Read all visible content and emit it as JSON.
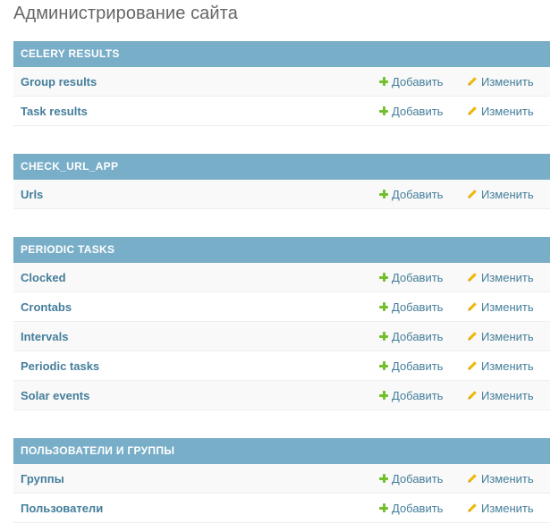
{
  "page_title": "Администрирование сайта",
  "modules": [
    {
      "caption": "CELERY RESULTS",
      "models": [
        {
          "name": "Group results",
          "add_label": "Добавить",
          "change_label": "Изменить"
        },
        {
          "name": "Task results",
          "add_label": "Добавить",
          "change_label": "Изменить"
        }
      ]
    },
    {
      "caption": "CHECK_URL_APP",
      "models": [
        {
          "name": "Urls",
          "add_label": "Добавить",
          "change_label": "Изменить"
        }
      ]
    },
    {
      "caption": "PERIODIC TASKS",
      "models": [
        {
          "name": "Clocked",
          "add_label": "Добавить",
          "change_label": "Изменить"
        },
        {
          "name": "Crontabs",
          "add_label": "Добавить",
          "change_label": "Изменить"
        },
        {
          "name": "Intervals",
          "add_label": "Добавить",
          "change_label": "Изменить"
        },
        {
          "name": "Periodic tasks",
          "add_label": "Добавить",
          "change_label": "Изменить"
        },
        {
          "name": "Solar events",
          "add_label": "Добавить",
          "change_label": "Изменить"
        }
      ]
    },
    {
      "caption": "ПОЛЬЗОВАТЕЛИ И ГРУППЫ",
      "models": [
        {
          "name": "Группы",
          "add_label": "Добавить",
          "change_label": "Изменить"
        },
        {
          "name": "Пользователи",
          "add_label": "Добавить",
          "change_label": "Изменить"
        }
      ]
    }
  ],
  "icons": {
    "add": "plus-icon",
    "change": "pencil-icon"
  },
  "colors": {
    "caption_bg": "#79aec8",
    "link": "#447e9b",
    "add_icon": "#70bf2b",
    "change_icon": "#efb80b"
  }
}
